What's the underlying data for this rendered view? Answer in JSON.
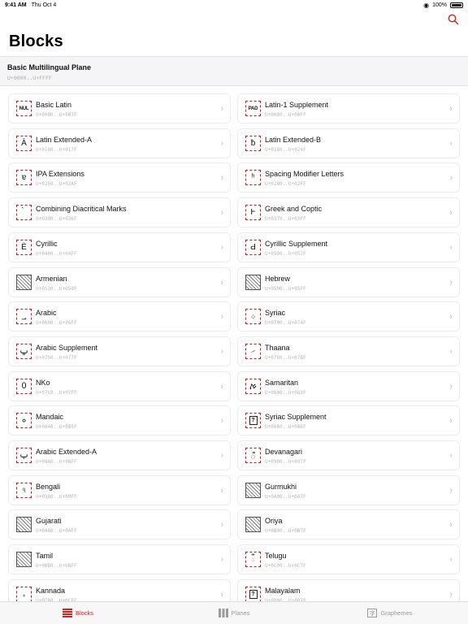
{
  "status": {
    "time": "9:41 AM",
    "date": "Thu Oct 4",
    "battery": "100%"
  },
  "page_title": "Blocks",
  "plane": {
    "name": "Basic Multilingual Plane",
    "range": "U+0000..U+FFFF"
  },
  "blocks": [
    {
      "name": "Basic Latin",
      "range": "U+0000..U+007F",
      "glyph": "NUL",
      "style": "tag"
    },
    {
      "name": "Latin-1 Supplement",
      "range": "U+0080..U+00FF",
      "glyph": "PAD",
      "style": "tag"
    },
    {
      "name": "Latin Extended-A",
      "range": "U+0100..U+017F",
      "glyph": "Ā",
      "style": "char"
    },
    {
      "name": "Latin Extended-B",
      "range": "U+0180..U+024F",
      "glyph": "ƀ",
      "style": "char"
    },
    {
      "name": "IPA Extensions",
      "range": "U+0250..U+02AF",
      "glyph": "ɐ",
      "style": "char"
    },
    {
      "name": "Spacing Modifier Letters",
      "range": "U+02B0..U+02FF",
      "glyph": "ʰ",
      "style": "char"
    },
    {
      "name": "Combining Diacritical Marks",
      "range": "U+0300..U+036F",
      "glyph": "̀",
      "style": "char"
    },
    {
      "name": "Greek and Coptic",
      "range": "U+0370..U+03FF",
      "glyph": "Ͱ",
      "style": "char"
    },
    {
      "name": "Cyrillic",
      "range": "U+0400..U+04FF",
      "glyph": "Ѐ",
      "style": "char"
    },
    {
      "name": "Cyrillic Supplement",
      "range": "U+0500..U+052F",
      "glyph": "Ԁ",
      "style": "char"
    },
    {
      "name": "Armenian",
      "range": "U+0530..U+058F",
      "glyph": "",
      "style": "hatch"
    },
    {
      "name": "Hebrew",
      "range": "U+0590..U+05FF",
      "glyph": "",
      "style": "hatch"
    },
    {
      "name": "Arabic",
      "range": "U+0600..U+06FF",
      "glyph": "؀",
      "style": "char"
    },
    {
      "name": "Syriac",
      "range": "U+0700..U+074F",
      "glyph": "܀",
      "style": "char"
    },
    {
      "name": "Arabic Supplement",
      "range": "U+0750..U+077F",
      "glyph": "ݐ",
      "style": "char"
    },
    {
      "name": "Thaana",
      "range": "U+0780..U+07BF",
      "glyph": "ހ",
      "style": "char"
    },
    {
      "name": "NKo",
      "range": "U+07C0..U+07FF",
      "glyph": "߀",
      "style": "char"
    },
    {
      "name": "Samaritan",
      "range": "U+0800..U+083F",
      "glyph": "ࠀ",
      "style": "char"
    },
    {
      "name": "Mandaic",
      "range": "U+0840..U+085F",
      "glyph": "ࡀ",
      "style": "char"
    },
    {
      "name": "Syriac Supplement",
      "range": "U+0860..U+086F",
      "glyph": "?",
      "style": "boxed"
    },
    {
      "name": "Arabic Extended-A",
      "range": "U+08A0..U+08FF",
      "glyph": "ࢠ",
      "style": "char"
    },
    {
      "name": "Devanagari",
      "range": "U+0900..U+097F",
      "glyph": "ऀ",
      "style": "char"
    },
    {
      "name": "Bengali",
      "range": "U+0980..U+09FF",
      "glyph": "ঀ",
      "style": "char"
    },
    {
      "name": "Gurmukhi",
      "range": "U+0A00..U+0A7F",
      "glyph": "",
      "style": "hatch"
    },
    {
      "name": "Gujarati",
      "range": "U+0A80..U+0AFF",
      "glyph": "",
      "style": "hatch"
    },
    {
      "name": "Oriya",
      "range": "U+0B00..U+0B7F",
      "glyph": "",
      "style": "hatch"
    },
    {
      "name": "Tamil",
      "range": "U+0B80..U+0BFF",
      "glyph": "",
      "style": "hatch"
    },
    {
      "name": "Telugu",
      "range": "U+0C00..U+0C7F",
      "glyph": "ఀ",
      "style": "char"
    },
    {
      "name": "Kannada",
      "range": "U+0C80..U+0CFF",
      "glyph": "ಀ",
      "style": "char"
    },
    {
      "name": "Malayalam",
      "range": "U+0D00..U+0D7F",
      "glyph": "?",
      "style": "boxed"
    }
  ],
  "tabs": [
    {
      "label": "Blocks",
      "icon": "list-icon",
      "active": true
    },
    {
      "label": "Planes",
      "icon": "grid-icon",
      "active": false
    },
    {
      "label": "Graphemes",
      "icon": "character-icon",
      "active": false
    }
  ],
  "colors": {
    "accent": "#d02020",
    "secondary_text": "#b8b8bc"
  }
}
